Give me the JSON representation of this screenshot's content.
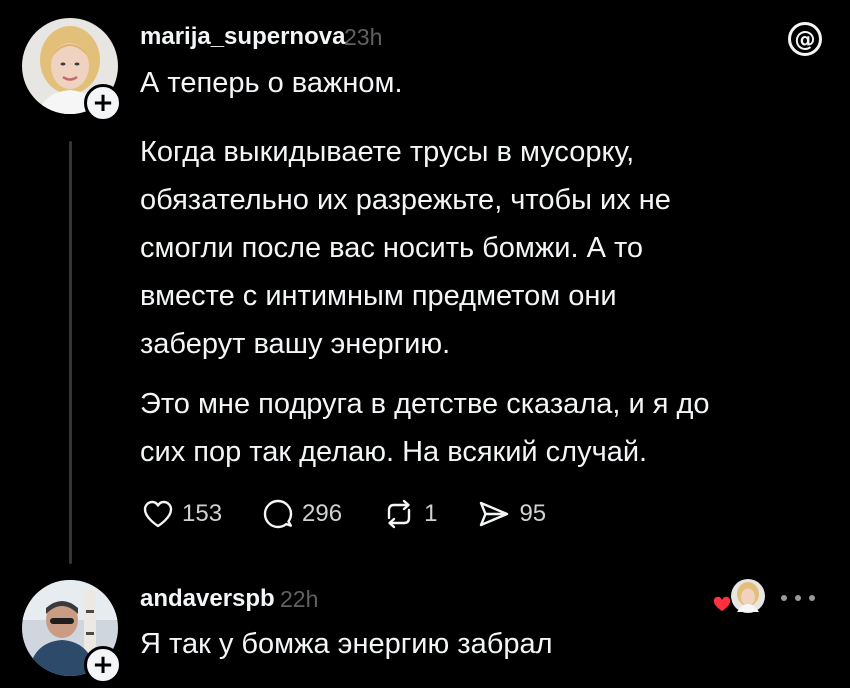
{
  "post": {
    "username": "marija_supernova",
    "timestamp": "23h",
    "paragraphs": [
      [
        "А теперь о важном."
      ],
      [
        "Когда выкидываете трусы в мусорку,",
        "обязательно их разрежьте, чтобы их не",
        "смогли после вас носить бомжи. А то",
        "вместе с интимным предметом они",
        "заберут вашу энергию."
      ],
      [
        "Это мне подруга в детстве сказала, и я до",
        "сих пор так делаю. На всякий случай."
      ]
    ],
    "actions": {
      "likes": "153",
      "replies": "296",
      "reposts": "1",
      "shares": "95"
    }
  },
  "reply": {
    "username": "andaverspb",
    "timestamp": "22h",
    "text": "Я так у бомжа энергию забрал"
  },
  "icons": {
    "app_logo": "threads-logo-icon",
    "like": "heart-icon",
    "reply": "speech-bubble-icon",
    "repost": "repost-icon",
    "share": "send-icon",
    "follow": "plus-icon",
    "more": "ellipsis-icon",
    "liked_by_author": "red-heart-icon"
  },
  "colors": {
    "background": "#000000",
    "text": "#f3f5f7",
    "muted": "#616161",
    "thread_line": "#333638",
    "like_red": "#ff3040"
  }
}
